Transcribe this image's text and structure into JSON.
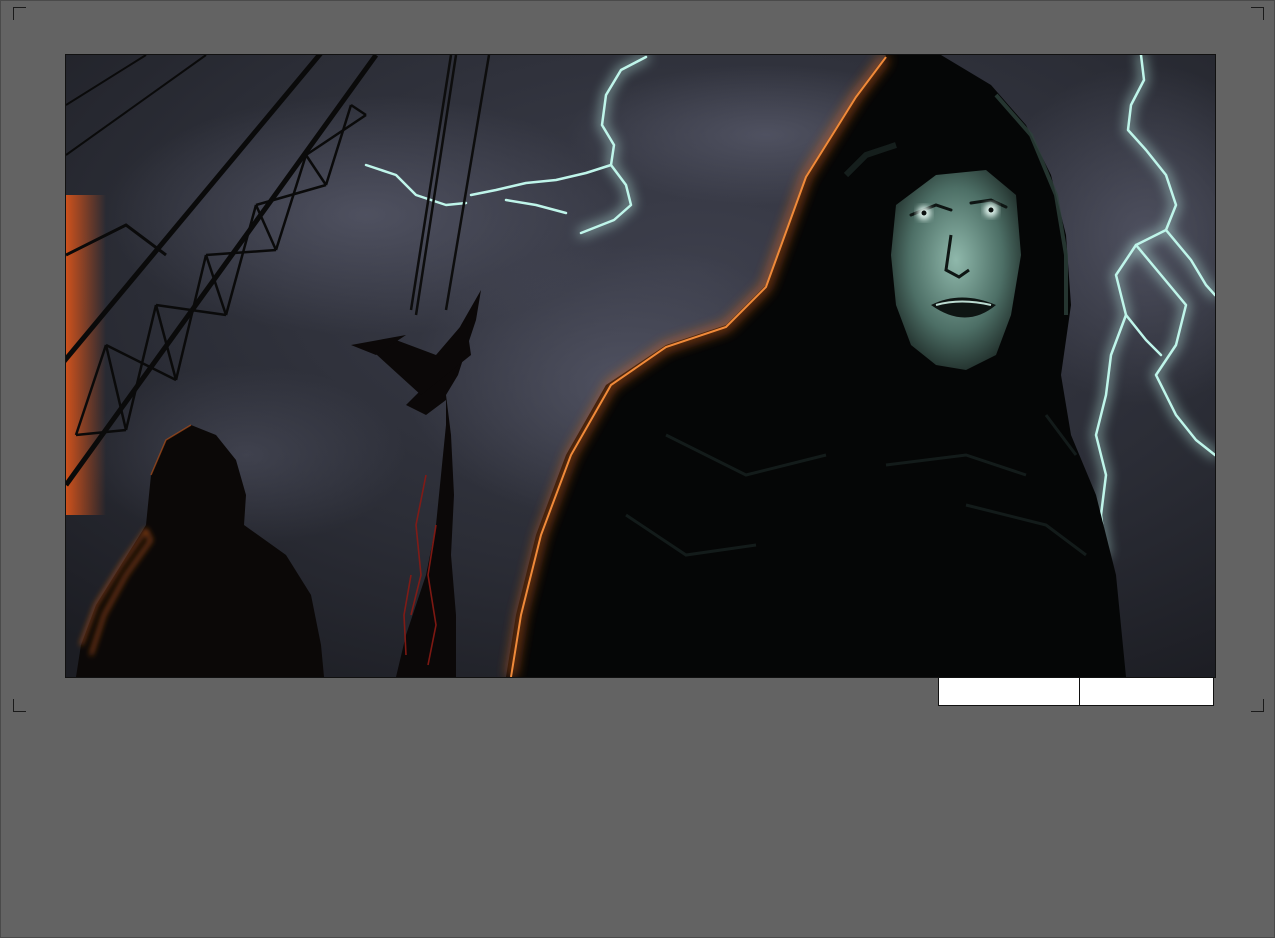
{
  "page": {
    "background_color": "#636363"
  },
  "panel": {
    "image_description_icon": "storyboard-illustration",
    "palette": {
      "sky": "#2b2e38",
      "cloud": "#4a4c5a",
      "lightning": "#bff5ea",
      "rim_light": "#e0661a",
      "face": "#7fa79b"
    }
  },
  "fields": {
    "scene_value": "",
    "shot_value": ""
  }
}
